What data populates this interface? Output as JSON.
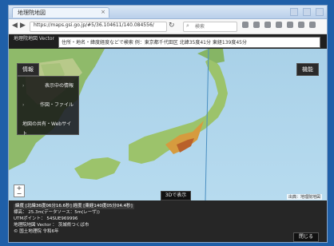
{
  "browser": {
    "tab_title": "地理院地図",
    "url": "https://maps.gsi.go.jp/#5/36.104611/140.084556/",
    "search_placeholder": "検索"
  },
  "blackbar": {
    "label": "地理院地図 Vector",
    "input_text": "住所・地名・緯度経度などで検索  例：東京都千代田区  北緯35度41分  東経139度45分"
  },
  "map": {
    "left_button": "情報",
    "right_button": "機能",
    "menu_items": [
      {
        "icon": "›",
        "label": "表示中の情報"
      },
      {
        "icon": "›",
        "label": "作図・ファイル"
      },
      {
        "icon": "",
        "label": "地図の共有・Webサイト"
      }
    ],
    "mini_button": "3Dで表示",
    "credit": "出典：地理院地図"
  },
  "panel": {
    "lines": [
      {
        "text": "緯度  [北緯36度06分16.6秒]  経度 [東経140度05分04.4秒]",
        "highlight": true
      },
      {
        "text": "標高：  25.3m(データソース：5m(レーザ))",
        "highlight": false
      },
      {
        "text": "UTMポイント：  54SUE969996",
        "highlight": false
      },
      {
        "text": "地理院地図  Vector  ：  茨城県つくば市",
        "highlight": false
      },
      {
        "text": "© 国土地理院  令和6年",
        "highlight": false
      }
    ],
    "close_button": "閉じる"
  }
}
